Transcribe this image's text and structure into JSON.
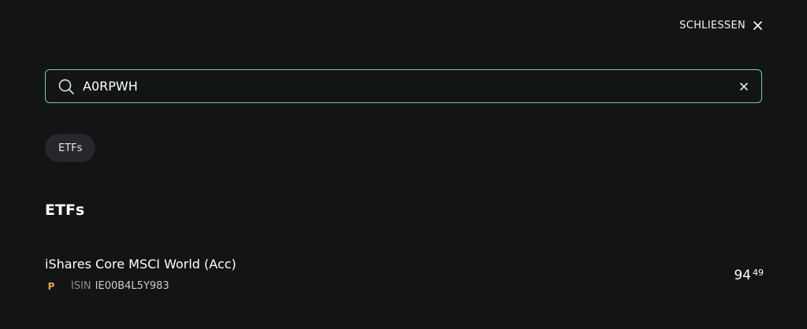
{
  "header": {
    "close_label": "SCHLIESSEN",
    "close_icon": "close-icon"
  },
  "search": {
    "value": "A0RPWH",
    "placeholder": "",
    "search_icon": "search-icon",
    "clear_icon": "clear-icon"
  },
  "filters": [
    {
      "label": "ETFs"
    }
  ],
  "sections": [
    {
      "title": "ETFs",
      "results": [
        {
          "name": "iShares Core MSCI World (Acc)",
          "badge": "P",
          "isin_label": "ISIN",
          "isin": "IE00B4L5Y983",
          "price_main": "94",
          "price_cents": "49"
        }
      ]
    }
  ],
  "colors": {
    "background": "#131416",
    "accent_border": "#63d4b8",
    "chip_background": "#25272b",
    "badge": "#f0a43a",
    "muted_text": "#8a8d92"
  }
}
